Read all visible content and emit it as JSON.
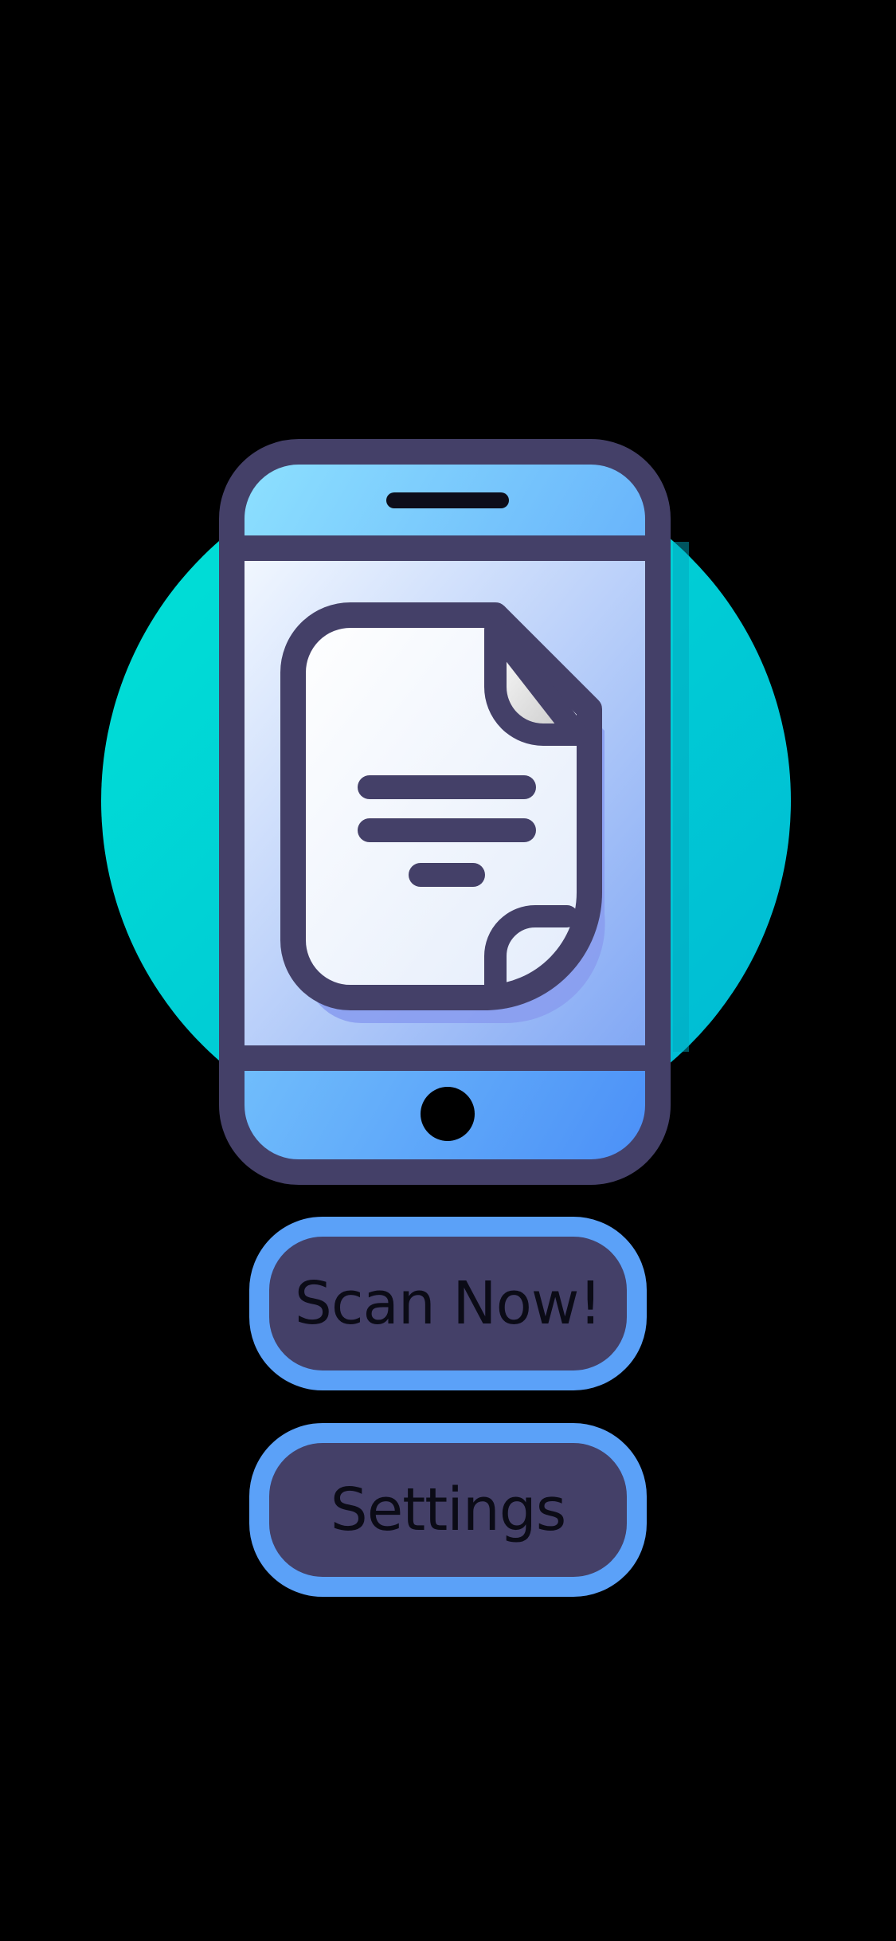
{
  "colors": {
    "background": "#000000",
    "circle_accent": "#00d2d6",
    "phone_outline": "#444068",
    "phone_body": "#59a6fb",
    "screen_light": "#eef6ff",
    "screen_dark": "#8ab3f7",
    "button_border": "#5ba1f8",
    "button_fill": "#444068",
    "button_text": "#0b0b16"
  },
  "hero": {
    "icon": "phone-document-icon"
  },
  "actions": {
    "scan_label": "Scan Now!",
    "settings_label": "Settings"
  }
}
